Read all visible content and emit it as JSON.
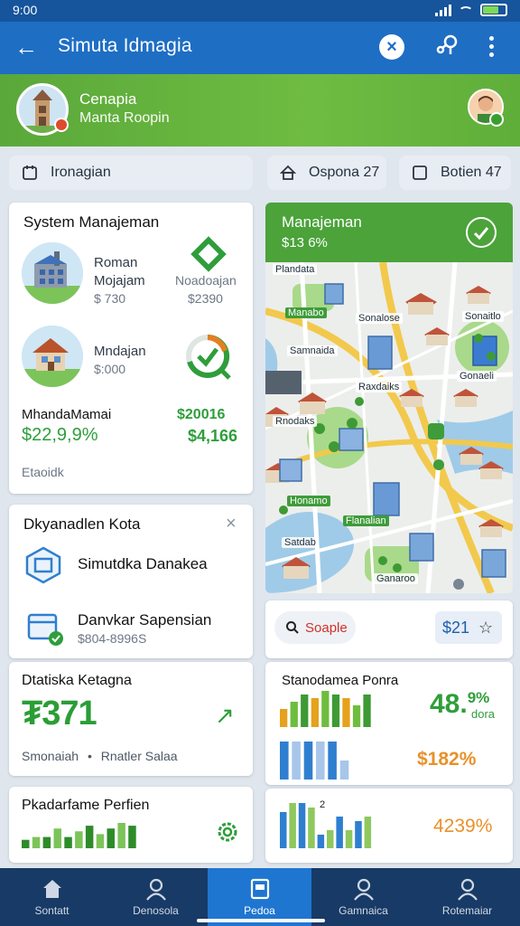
{
  "status": {
    "time": "9:00"
  },
  "app_bar": {
    "title": "Simuta Idmagia"
  },
  "banner": {
    "title": "Cenapia",
    "subtitle": "Manta Roopin"
  },
  "chips": [
    {
      "label": "Ironagian"
    },
    {
      "label": "Ospona 27"
    },
    {
      "label": "Botien 47"
    }
  ],
  "system_card": {
    "title": "System Manajeman",
    "item1": {
      "name": "Roman",
      "sub": "Mojajam",
      "price": "$ 730"
    },
    "item2": {
      "name": "Noadoajan",
      "price": "$2390"
    },
    "item3": {
      "name": "Mndajan",
      "price": "$:000"
    },
    "summary_left_label": "MhandaMamai",
    "summary_left_value": "$22,9,9%",
    "summary_right_label": "$20016",
    "summary_right_value": "$4,166",
    "footer": "Etaoidk"
  },
  "map_card": {
    "title": "Manajeman",
    "value": "$13 6%",
    "labels": [
      "Plandata",
      "Sonalose",
      "Sonaitlo",
      "Samnaida",
      "Gonaeli",
      "Raxdaiks",
      "Rnodaks",
      "Satdab",
      "Ganaroo"
    ],
    "green_labels": [
      "Manabo",
      "Honamo",
      "Flanalian"
    ]
  },
  "district_card": {
    "title": "Dkyanadlen Kota",
    "item1": "Simutdka Danakea",
    "item2": "Danvkar Sapensian",
    "item2_sub": "$804-8996S"
  },
  "search_card": {
    "search_label": "Soaple",
    "price_label": "$21"
  },
  "stats_card": {
    "title": "Dtatiska Ketagna",
    "value": "₮371",
    "foot1": "Smonaiah",
    "foot2": "Rnatler Salaa"
  },
  "chart_card": {
    "title": "Stanodamea Ponra",
    "value1": "48.",
    "value1_small": "9%",
    "value1_sub": "dora",
    "value2": "$182%"
  },
  "chart_card2": {
    "marker": "2",
    "value": "4239%"
  },
  "perf_card": {
    "title": "Pkadarfame Perfien"
  },
  "chart_data": [
    {
      "type": "bar",
      "title": "Pkadarfame Perfien",
      "series": [
        {
          "values": [
            3,
            4,
            4,
            7,
            4,
            6,
            8,
            5,
            7,
            9,
            8
          ]
        }
      ],
      "colors": [
        "#2e8b2a",
        "#7cc45a"
      ]
    },
    {
      "type": "bar",
      "title": "Stanodamea Ponra",
      "series": [
        {
          "values": [
            5,
            7,
            9,
            8,
            10,
            9,
            8,
            6,
            9
          ]
        }
      ],
      "colors": [
        "#e6a21c",
        "#6fbd3e",
        "#3e9a35"
      ]
    },
    {
      "type": "bar",
      "series": [
        {
          "values": [
            10,
            10,
            10,
            10,
            10,
            5
          ]
        }
      ],
      "colors": [
        "#2f7fd0",
        "#a7c6ea"
      ]
    },
    {
      "type": "bar",
      "series": [
        {
          "values": [
            8,
            10,
            10,
            9,
            3,
            4,
            7,
            4,
            6,
            7
          ]
        }
      ],
      "colors": [
        "#2f7fd0",
        "#8fc85f"
      ]
    }
  ],
  "bottom_nav": [
    {
      "label": "Sontatt",
      "icon": "home-icon"
    },
    {
      "label": "Denosola",
      "icon": "person-icon"
    },
    {
      "label": "Pedoa",
      "icon": "doc-icon"
    },
    {
      "label": "Gamnaica",
      "icon": "person-icon"
    },
    {
      "label": "Rotemaiar",
      "icon": "person-icon"
    }
  ],
  "colors": {
    "primary": "#1e6ec4",
    "green": "#4ba33a",
    "nav": "#183a66"
  }
}
